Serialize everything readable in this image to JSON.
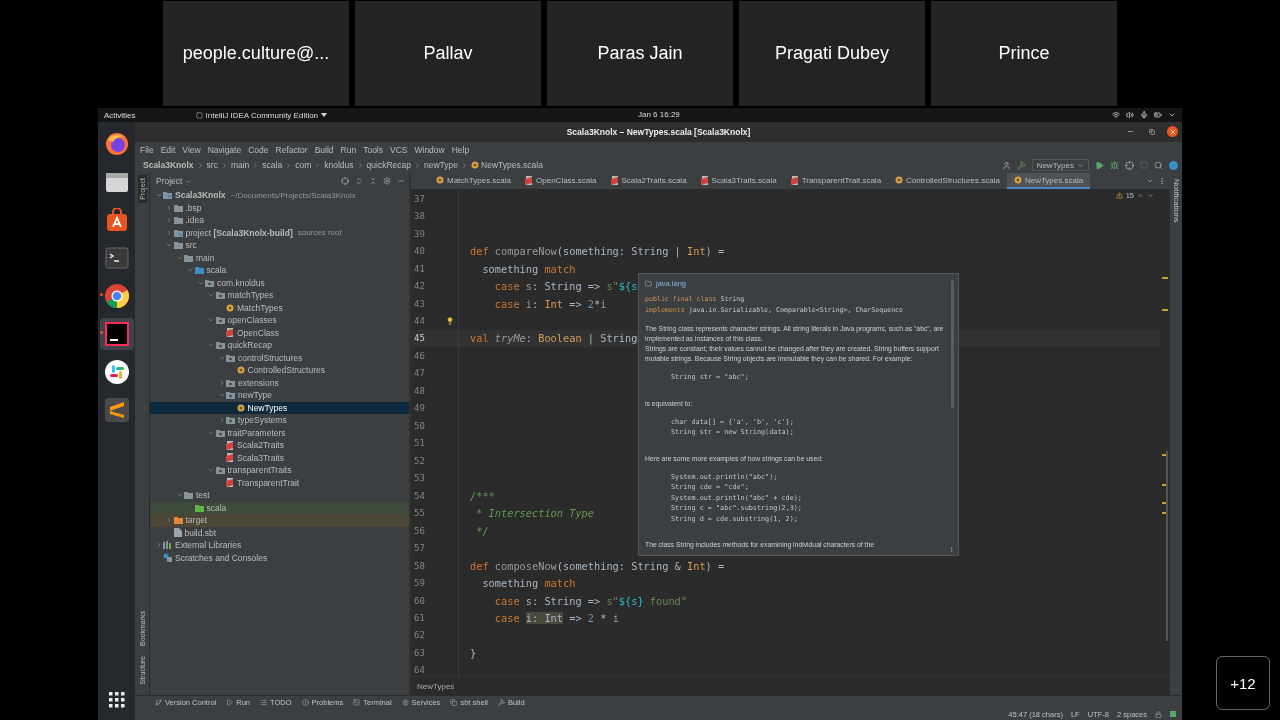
{
  "meeting": {
    "participants": [
      {
        "name": "people.culture@..."
      },
      {
        "name": "Pallav"
      },
      {
        "name": "Paras Jain"
      },
      {
        "name": "Pragati Dubey"
      },
      {
        "name": "Prince"
      }
    ],
    "more_count": "+12"
  },
  "desktop": {
    "activities": "Activities",
    "app_menu": "IntelliJ IDEA Community Edition",
    "clock": "Jan 6  16:29",
    "dock": [
      {
        "kind": "fox",
        "selected": false,
        "running": false
      },
      {
        "kind": "files",
        "selected": false,
        "running": false
      },
      {
        "kind": "store",
        "selected": false,
        "running": false
      },
      {
        "kind": "terminal",
        "selected": false,
        "running": false
      },
      {
        "kind": "ring",
        "selected": false,
        "running": true
      },
      {
        "kind": "ide",
        "selected": true,
        "running": true
      },
      {
        "kind": "chat",
        "selected": false,
        "running": false
      },
      {
        "kind": "editor",
        "selected": false,
        "running": false
      }
    ]
  },
  "ide": {
    "title": "Scala3Knolx – NewTypes.scala [Scala3Knolx]",
    "menu": [
      "File",
      "Edit",
      "View",
      "Navigate",
      "Code",
      "Refactor",
      "Build",
      "Run",
      "Tools",
      "VCS",
      "Window",
      "Help"
    ],
    "breadcrumbs": [
      {
        "label": "Scala3Knolx",
        "kind": "module"
      },
      {
        "label": "src",
        "kind": "dir"
      },
      {
        "label": "main",
        "kind": "dir"
      },
      {
        "label": "scala",
        "kind": "dir"
      },
      {
        "label": "com",
        "kind": "dir"
      },
      {
        "label": "knoldus",
        "kind": "dir"
      },
      {
        "label": "quickRecap",
        "kind": "dir"
      },
      {
        "label": "newType",
        "kind": "dir"
      },
      {
        "label": "NewTypes.scala",
        "kind": "object"
      }
    ],
    "run_config": "NewTypes",
    "left_tool_windows": [
      {
        "label": "Project",
        "selected": true
      },
      {
        "label": "Bookmarks",
        "selected": false
      },
      {
        "label": "Structure",
        "selected": false
      }
    ],
    "right_tool_windows": [
      "Notifications"
    ],
    "project_panel": {
      "title": "Project",
      "tree": [
        {
          "label": "Scala3Knolx",
          "kind": "module",
          "hint": "~/Documents/Projects/Scala3Knolx",
          "expanded": true,
          "selected": false,
          "children": [
            {
              "label": ".bsp",
              "kind": "folder",
              "expanded": false,
              "selected": false
            },
            {
              "label": ".idea",
              "kind": "folder",
              "expanded": false,
              "selected": false
            },
            {
              "label": "project **[Scala3Knolx-build]**",
              "kind": "module",
              "hint": "sources root",
              "expanded": false,
              "selected": false
            },
            {
              "label": "src",
              "kind": "folder",
              "expanded": true,
              "selected": false,
              "children": [
                {
                  "label": "main",
                  "kind": "folder",
                  "expanded": true,
                  "selected": false,
                  "children": [
                    {
                      "label": "scala",
                      "kind": "source-root",
                      "expanded": true,
                      "selected": false,
                      "children": [
                        {
                          "label": "com.knoldus",
                          "kind": "package",
                          "expanded": true,
                          "selected": false,
                          "children": [
                            {
                              "label": "matchTypes",
                              "kind": "package",
                              "expanded": true,
                              "selected": false,
                              "children": [
                                {
                                  "label": "MatchTypes",
                                  "kind": "object",
                                  "selected": false
                                }
                              ]
                            },
                            {
                              "label": "openClasses",
                              "kind": "package",
                              "expanded": true,
                              "selected": false,
                              "children": [
                                {
                                  "label": "OpenClass",
                                  "kind": "class",
                                  "selected": false
                                }
                              ]
                            },
                            {
                              "label": "quickRecap",
                              "kind": "package",
                              "expanded": true,
                              "selected": false,
                              "children": [
                                {
                                  "label": "controlStructures",
                                  "kind": "package",
                                  "expanded": true,
                                  "selected": false,
                                  "children": [
                                    {
                                      "label": "ControlledStructures",
                                      "kind": "object",
                                      "selected": false
                                    }
                                  ]
                                },
                                {
                                  "label": "extensions",
                                  "kind": "package",
                                  "expanded": false,
                                  "selected": false
                                },
                                {
                                  "label": "newType",
                                  "kind": "package",
                                  "expanded": true,
                                  "selected": false,
                                  "children": [
                                    {
                                      "label": "NewTypes",
                                      "kind": "object",
                                      "selected": true
                                    }
                                  ]
                                },
                                {
                                  "label": "typeSystems",
                                  "kind": "package",
                                  "expanded": false,
                                  "selected": false
                                }
                              ]
                            },
                            {
                              "label": "traitParameters",
                              "kind": "package",
                              "expanded": true,
                              "selected": false,
                              "children": [
                                {
                                  "label": "Scala2Traits",
                                  "kind": "class",
                                  "selected": false
                                },
                                {
                                  "label": "Scala3Traits",
                                  "kind": "class",
                                  "selected": false
                                }
                              ]
                            },
                            {
                              "label": "transparentTraits",
                              "kind": "package",
                              "expanded": true,
                              "selected": false,
                              "children": [
                                {
                                  "label": "TransparentTrait",
                                  "kind": "class",
                                  "selected": false
                                }
                              ]
                            }
                          ]
                        }
                      ]
                    }
                  ]
                },
                {
                  "label": "test",
                  "kind": "folder",
                  "expanded": true,
                  "selected": false,
                  "children": [
                    {
                      "label": "scala",
                      "kind": "test-root",
                      "selected": false
                    }
                  ]
                }
              ]
            },
            {
              "label": "target",
              "kind": "excluded",
              "expanded": false,
              "selected": false
            },
            {
              "label": "build.sbt",
              "kind": "sbt",
              "selected": false
            }
          ]
        },
        {
          "label": "External Libraries",
          "kind": "libraries",
          "expanded": false,
          "selected": false
        },
        {
          "label": "Scratches and Consoles",
          "kind": "scratches",
          "selected": false
        }
      ]
    },
    "tabs": [
      {
        "label": "MatchTypes.scala",
        "kind": "object",
        "selected": false
      },
      {
        "label": "OpenClass.scala",
        "kind": "class",
        "selected": false
      },
      {
        "label": "Scala2Traits.scala",
        "kind": "class",
        "selected": false
      },
      {
        "label": "Scala3Traits.scala",
        "kind": "class",
        "selected": false
      },
      {
        "label": "TransparentTrait.scala",
        "kind": "class",
        "selected": false
      },
      {
        "label": "ControlledStructures.scala",
        "kind": "object",
        "selected": false
      },
      {
        "label": "NewTypes.scala",
        "kind": "object",
        "selected": true
      }
    ],
    "editor": {
      "warnings": "15",
      "lines": [
        {
          "number": "37",
          "current": false,
          "intention": false
        },
        {
          "number": "38",
          "current": false,
          "intention": false
        },
        {
          "number": "39",
          "current": false,
          "intention": false
        },
        {
          "number": "40",
          "current": false,
          "intention": false,
          "tokens": [
            {
              "text": "def ",
              "kind": "kw"
            },
            {
              "text": "compareNow",
              "kind": "dim"
            },
            {
              "text": "(something: String | ",
              "kind": "plain"
            },
            {
              "text": "Int",
              "kind": "type"
            },
            {
              "text": ") =",
              "kind": "plain"
            }
          ]
        },
        {
          "number": "41",
          "current": false,
          "intention": false,
          "tokens": [
            {
              "text": "  something ",
              "kind": "plain"
            },
            {
              "text": "match",
              "kind": "kw"
            }
          ]
        },
        {
          "number": "42",
          "current": false,
          "intention": false,
          "tokens": [
            {
              "text": "    case",
              "kind": "kw"
            },
            {
              "text": " s",
              "kind": "dim"
            },
            {
              "text": ": String => ",
              "kind": "plain"
            },
            {
              "text": "s\"",
              "kind": "str"
            },
            {
              "text": "${s",
              "kind": "interp"
            }
          ]
        },
        {
          "number": "43",
          "current": false,
          "intention": false,
          "tokens": [
            {
              "text": "    case",
              "kind": "kw"
            },
            {
              "text": " i",
              "kind": "dim"
            },
            {
              "text": ": ",
              "kind": "plain"
            },
            {
              "text": "Int",
              "kind": "type"
            },
            {
              "text": " => ",
              "kind": "plain"
            },
            {
              "text": "2",
              "kind": "num"
            },
            {
              "text": "*",
              "kind": "plain"
            },
            {
              "text": "i",
              "kind": "dim"
            }
          ]
        },
        {
          "number": "44",
          "current": false,
          "intention": true
        },
        {
          "number": "45",
          "current": true,
          "intention": false,
          "tokens": [
            {
              "text": "val ",
              "kind": "kw"
            },
            {
              "text": "tryMe",
              "kind": "field"
            },
            {
              "text": ": ",
              "kind": "plain"
            },
            {
              "text": "Boolean",
              "kind": "type"
            },
            {
              "text": " | String",
              "kind": "plain"
            }
          ]
        },
        {
          "number": "46",
          "current": false,
          "intention": false
        },
        {
          "number": "47",
          "current": false,
          "intention": false
        },
        {
          "number": "48",
          "current": false,
          "intention": false
        },
        {
          "number": "49",
          "current": false,
          "intention": false
        },
        {
          "number": "50",
          "current": false,
          "intention": false
        },
        {
          "number": "51",
          "current": false,
          "intention": false
        },
        {
          "number": "52",
          "current": false,
          "intention": false
        },
        {
          "number": "53",
          "current": false,
          "intention": false
        },
        {
          "number": "54",
          "current": false,
          "intention": false,
          "tokens": [
            {
              "text": "/***",
              "kind": "doc"
            }
          ]
        },
        {
          "number": "55",
          "current": false,
          "intention": false,
          "tokens": [
            {
              "text": " * Intersection Type",
              "kind": "doc"
            }
          ]
        },
        {
          "number": "56",
          "current": false,
          "intention": false,
          "tokens": [
            {
              "text": " */",
              "kind": "doc"
            }
          ]
        },
        {
          "number": "57",
          "current": false,
          "intention": false
        },
        {
          "number": "58",
          "current": false,
          "intention": false,
          "tokens": [
            {
              "text": "def ",
              "kind": "kw"
            },
            {
              "text": "composeNow",
              "kind": "dim"
            },
            {
              "text": "(something: String & ",
              "kind": "plain"
            },
            {
              "text": "Int",
              "kind": "type"
            },
            {
              "text": ") =",
              "kind": "plain"
            }
          ]
        },
        {
          "number": "59",
          "current": false,
          "intention": false,
          "tokens": [
            {
              "text": "  something ",
              "kind": "plain"
            },
            {
              "text": "match",
              "kind": "kw"
            }
          ]
        },
        {
          "number": "60",
          "current": false,
          "intention": false,
          "tokens": [
            {
              "text": "    case",
              "kind": "kw"
            },
            {
              "text": " s: String => ",
              "kind": "plain"
            },
            {
              "text": "s\"",
              "kind": "str"
            },
            {
              "text": "${s}",
              "kind": "interp"
            },
            {
              "text": " found\"",
              "kind": "str"
            }
          ]
        },
        {
          "number": "61",
          "current": false,
          "intention": false,
          "tokens": [
            {
              "text": "    case ",
              "kind": "kw"
            },
            {
              "text": "i: Int",
              "kind": "hl"
            },
            {
              "text": " => ",
              "kind": "plain"
            },
            {
              "text": "2",
              "kind": "num"
            },
            {
              "text": " * ",
              "kind": "plain"
            },
            {
              "text": "i",
              "kind": "dim"
            }
          ]
        },
        {
          "number": "62",
          "current": false,
          "intention": false
        },
        {
          "number": "63",
          "current": false,
          "intention": false,
          "tokens": [
            {
              "text": "}",
              "kind": "plain"
            }
          ]
        },
        {
          "number": "64",
          "current": false,
          "intention": false
        }
      ],
      "breadcrumb": "NewTypes",
      "doc_popup": {
        "package": "java.lang",
        "signature": [
          [
            {
              "text": "public final class",
              "kind": "kw"
            },
            {
              "text": " String",
              "kind": "plain"
            }
          ],
          [
            {
              "text": "implements",
              "kind": "kw"
            },
            {
              "text": " java.io.Serializable, Comparable<String>, CharSequence",
              "kind": "plain"
            }
          ]
        ],
        "blocks": [
          {
            "kind": "text",
            "text": "The String class represents character strings. All string literals in Java programs, such as \"abc\", are implemented as instances of this class."
          },
          {
            "kind": "text",
            "text": "Strings are constant; their values cannot be changed after they are created. String buffers support mutable strings. Because String objects are immutable they can be shared. For example:"
          },
          {
            "kind": "code",
            "lines": [
              "String str = \"abc\";"
            ]
          },
          {
            "kind": "text",
            "text": "is equivalent to:"
          },
          {
            "kind": "code",
            "lines": [
              "char data[] = {'a', 'b', 'c'};",
              "String str = new String(data);"
            ]
          },
          {
            "kind": "text",
            "text": "Here are some more examples of how strings can be used:"
          },
          {
            "kind": "code",
            "lines": [
              "System.out.println(\"abc\");",
              "String cde = \"cde\";",
              "System.out.println(\"abc\" + cde);",
              "String c = \"abc\".substring(2,3);",
              "String d = cde.substring(1, 2);"
            ]
          },
          {
            "kind": "text",
            "text": "The class  String includes methods for examining individual characters of the"
          }
        ]
      }
    },
    "bottom_tools": [
      {
        "label": "Version Control",
        "kind": "vcs"
      },
      {
        "label": "Run",
        "kind": "run"
      },
      {
        "label": "TODO",
        "kind": "todo"
      },
      {
        "label": "Problems",
        "kind": "problems"
      },
      {
        "label": "Terminal",
        "kind": "terminal"
      },
      {
        "label": "Services",
        "kind": "services"
      },
      {
        "label": "sbt shell",
        "kind": "shell"
      },
      {
        "label": "Build",
        "kind": "build"
      }
    ],
    "status": {
      "position": "45:47 (18 chars)",
      "line_separator": "LF",
      "encoding": "UTF-8",
      "indent": "2 spaces"
    }
  }
}
